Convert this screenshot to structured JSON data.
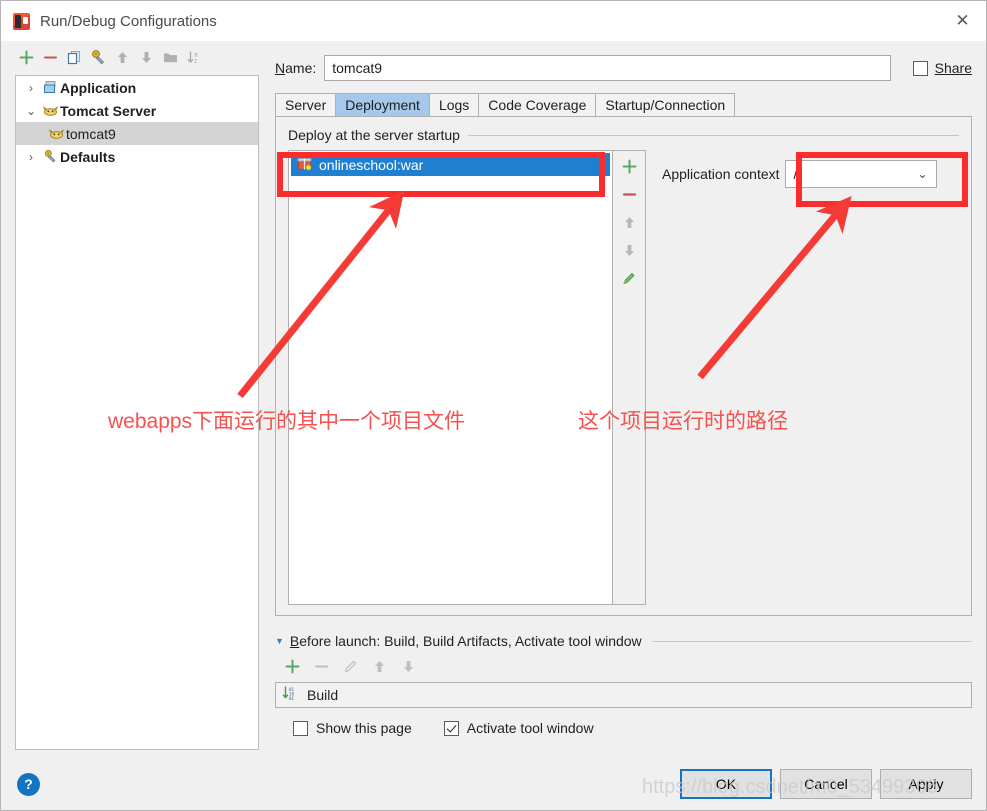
{
  "window": {
    "title": "Run/Debug Configurations",
    "app_icon": "intellij-idea-icon",
    "close_icon": "✕"
  },
  "left_toolbar": {
    "items": [
      {
        "name": "add-configuration-button",
        "icon": "plus-icon",
        "glyph": "+"
      },
      {
        "name": "remove-configuration-button",
        "icon": "minus-icon",
        "glyph": "−"
      },
      {
        "name": "copy-configuration-button",
        "icon": "copy-icon",
        "glyph": "⧉"
      },
      {
        "name": "edit-templates-button",
        "icon": "wrench-icon",
        "glyph": "🔧"
      },
      {
        "name": "move-up-button",
        "icon": "arrow-up-icon",
        "glyph": "↑"
      },
      {
        "name": "move-down-button",
        "icon": "arrow-down-icon",
        "glyph": "↓"
      },
      {
        "name": "move-into-folder-button",
        "icon": "folder-icon",
        "glyph": "▮"
      },
      {
        "name": "sort-configurations-button",
        "icon": "sort-alpha-icon",
        "glyph": "↓"
      }
    ]
  },
  "tree": {
    "items": [
      {
        "label": "Application",
        "twisty": "›",
        "icon": "application-icon",
        "level": 0,
        "selected": false
      },
      {
        "label": "Tomcat Server",
        "twisty": "⌄",
        "icon": "tomcat-icon",
        "level": 0,
        "selected": false
      },
      {
        "label": "tomcat9",
        "twisty": "",
        "icon": "tomcat-icon",
        "level": 1,
        "selected": true
      },
      {
        "label": "Defaults",
        "twisty": "›",
        "icon": "wrench-icon",
        "level": 0,
        "selected": false
      }
    ]
  },
  "name_row": {
    "label_prefix": "N",
    "label_rest": "ame:",
    "value": "tomcat9",
    "placeholder": "",
    "share_label": "Share",
    "share_checked": false
  },
  "tabs": [
    {
      "label": "Server",
      "active": false
    },
    {
      "label": "Deployment",
      "active": true
    },
    {
      "label": "Logs",
      "active": false
    },
    {
      "label": "Code Coverage",
      "active": false
    },
    {
      "label": "Startup/Connection",
      "active": false
    }
  ],
  "deployment": {
    "group_title": "Deploy at the server startup",
    "items": [
      {
        "label": "onlineschool:war",
        "icon": "artifact-war-icon",
        "selected": true
      }
    ],
    "toolbar": [
      {
        "name": "add-artifact-button",
        "icon": "plus-icon",
        "glyph": "+"
      },
      {
        "name": "remove-artifact-button",
        "icon": "minus-icon",
        "glyph": "−"
      },
      {
        "name": "move-artifact-up-button",
        "icon": "arrow-up-icon",
        "glyph": "↑"
      },
      {
        "name": "move-artifact-down-button",
        "icon": "arrow-down-icon",
        "glyph": "↓"
      },
      {
        "name": "edit-artifact-button",
        "icon": "pencil-icon",
        "glyph": "✏"
      }
    ],
    "context_label": "Application context",
    "context_value": "/",
    "context_chevron": "⌄"
  },
  "before_launch": {
    "triangle": "▼",
    "title_prefix": "B",
    "title_rest": "efore launch: Build, Build Artifacts, Activate tool window",
    "toolbar": [
      {
        "name": "add-task-button",
        "icon": "plus-icon",
        "glyph": "+"
      },
      {
        "name": "remove-task-button",
        "icon": "minus-icon",
        "glyph": "−"
      },
      {
        "name": "edit-task-button",
        "icon": "pencil-icon",
        "glyph": "✏"
      },
      {
        "name": "move-task-up-button",
        "icon": "arrow-up-icon",
        "glyph": "↑"
      },
      {
        "name": "move-task-down-button",
        "icon": "arrow-down-icon",
        "glyph": "↓"
      }
    ],
    "tasks": [
      {
        "label": "Build",
        "icon": "build-icon"
      }
    ],
    "show_page_label": "Show this page",
    "show_page_checked": false,
    "activate_tool_window_label": "Activate tool window",
    "activate_tool_window_checked": true
  },
  "footer": {
    "help_glyph": "?",
    "ok_label": "OK",
    "cancel_label": "Cancel",
    "apply_label": "Apply"
  },
  "annotations": {
    "color": "#fb2c2c",
    "text_color": "#f6514f",
    "note_left": "webapps下面运行的其中一个项目文件",
    "note_right": "这个项目运行时的路径"
  },
  "watermark": "https://blog.csdnet/m0_53499366"
}
